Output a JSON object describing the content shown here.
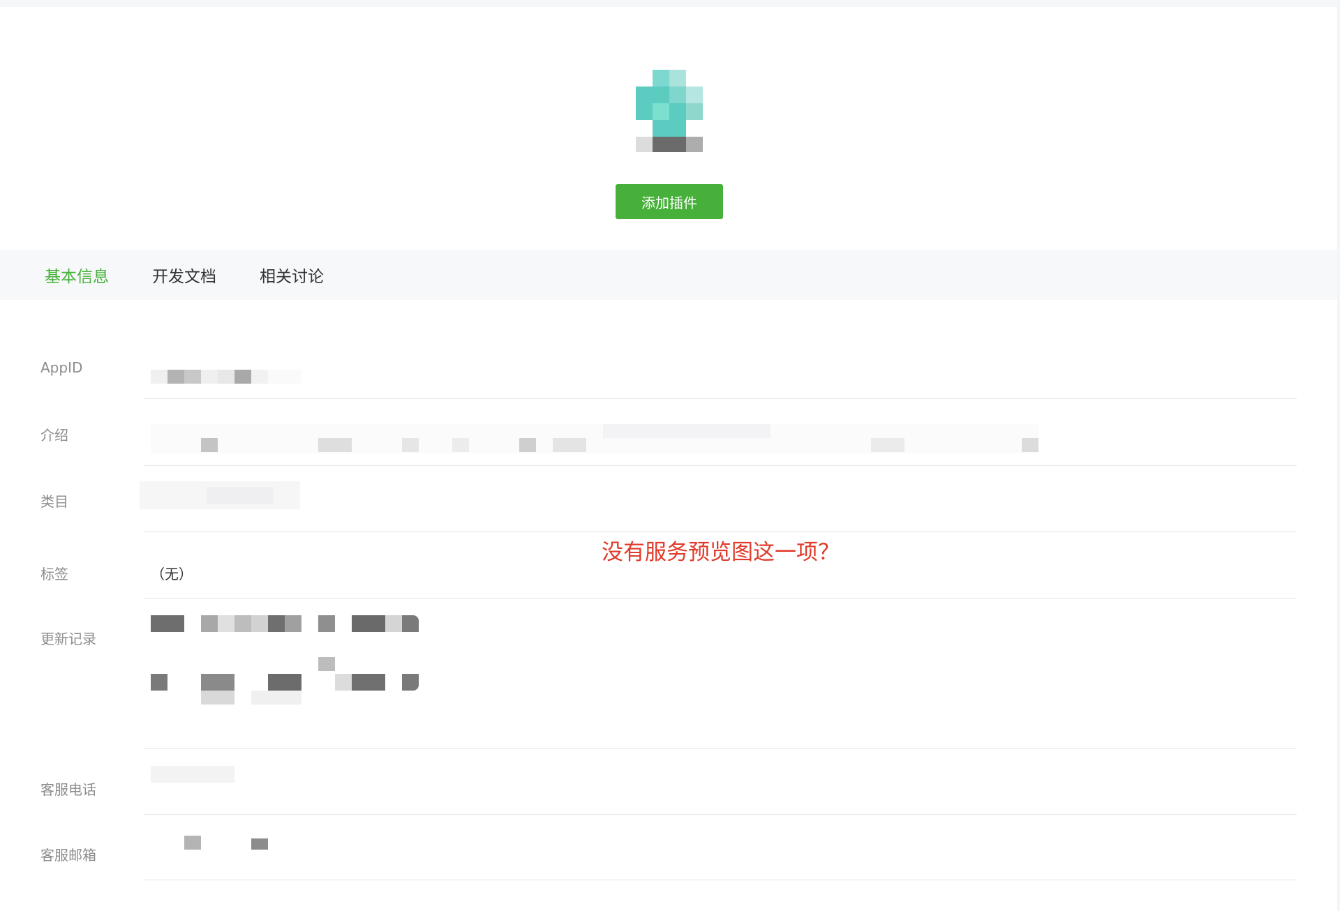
{
  "header": {
    "add_plugin_button": "添加插件"
  },
  "tabs": [
    {
      "label": "基本信息",
      "active": true
    },
    {
      "label": "开发文档",
      "active": false
    },
    {
      "label": "相关讨论",
      "active": false
    }
  ],
  "info": {
    "appid_label": "AppID",
    "intro_label": "介绍",
    "category_label": "类目",
    "tags_label": "标签",
    "tags_value": "（无）",
    "changelog_label": "更新记录",
    "phone_label": "客服电话",
    "email_label": "客服邮箱"
  },
  "annotation": "没有服务预览图这一项？",
  "colors": {
    "accent": "#46b03a",
    "annotation": "#e03a2a"
  }
}
